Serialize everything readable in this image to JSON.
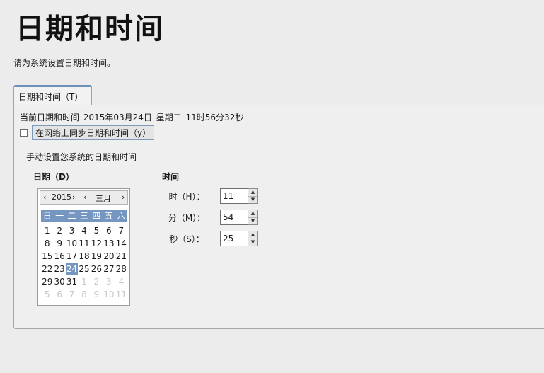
{
  "page": {
    "title": "日期和时间",
    "subtitle": "请为系统设置日期和时间。"
  },
  "tab": {
    "label": "日期和时间（T）"
  },
  "current": {
    "text": "当前日期和时间   2015年03月24日  星期二  11时56分32秒"
  },
  "sync": {
    "label": "在网络上同步日期和时间（y）",
    "checked": false
  },
  "manual": {
    "label": "手动设置您系统的日期和时间"
  },
  "date_section": {
    "label": "日期（D）"
  },
  "time_section": {
    "label": "时间"
  },
  "calendar": {
    "year": "2015",
    "month": "三月",
    "weekdays": [
      "日",
      "一",
      "二",
      "三",
      "四",
      "五",
      "六"
    ],
    "days": [
      [
        {
          "d": "1",
          "o": false
        },
        {
          "d": "2",
          "o": false
        },
        {
          "d": "3",
          "o": false
        },
        {
          "d": "4",
          "o": false
        },
        {
          "d": "5",
          "o": false
        },
        {
          "d": "6",
          "o": false
        },
        {
          "d": "7",
          "o": false
        },
        {
          "d": "8",
          "o": false
        },
        {
          "d": "9",
          "o": false
        },
        {
          "d": "10",
          "o": false
        },
        {
          "d": "11",
          "o": false
        },
        {
          "d": "12",
          "o": false
        },
        {
          "d": "13",
          "o": false
        },
        {
          "d": "14",
          "o": false
        },
        {
          "d": "15",
          "o": false
        },
        {
          "d": "16",
          "o": false
        },
        {
          "d": "17",
          "o": false
        },
        {
          "d": "18",
          "o": false
        },
        {
          "d": "19",
          "o": false
        },
        {
          "d": "20",
          "o": false
        },
        {
          "d": "21",
          "o": false
        },
        {
          "d": "22",
          "o": false
        },
        {
          "d": "23",
          "o": false
        },
        {
          "d": "24",
          "o": false,
          "sel": true
        },
        {
          "d": "25",
          "o": false
        },
        {
          "d": "26",
          "o": false
        },
        {
          "d": "27",
          "o": false
        },
        {
          "d": "28",
          "o": false
        },
        {
          "d": "29",
          "o": false
        },
        {
          "d": "30",
          "o": false
        },
        {
          "d": "31",
          "o": false
        },
        {
          "d": "1",
          "o": true
        },
        {
          "d": "2",
          "o": true
        },
        {
          "d": "3",
          "o": true
        },
        {
          "d": "4",
          "o": true
        },
        {
          "d": "5",
          "o": true
        },
        {
          "d": "6",
          "o": true
        },
        {
          "d": "7",
          "o": true
        },
        {
          "d": "8",
          "o": true
        },
        {
          "d": "9",
          "o": true
        },
        {
          "d": "10",
          "o": true
        },
        {
          "d": "11",
          "o": true
        }
      ]
    ]
  },
  "time": {
    "hour": {
      "label": "时（H）：",
      "value": "11"
    },
    "minute": {
      "label": "分（M）：",
      "value": "54"
    },
    "second": {
      "label": "秒（S）：",
      "value": "25"
    }
  },
  "icons": {
    "prev": "‹",
    "next": "›",
    "spin_up": "▲",
    "spin_down": "▼"
  },
  "colors": {
    "accent": "#7596c0",
    "background": "#ececec"
  }
}
